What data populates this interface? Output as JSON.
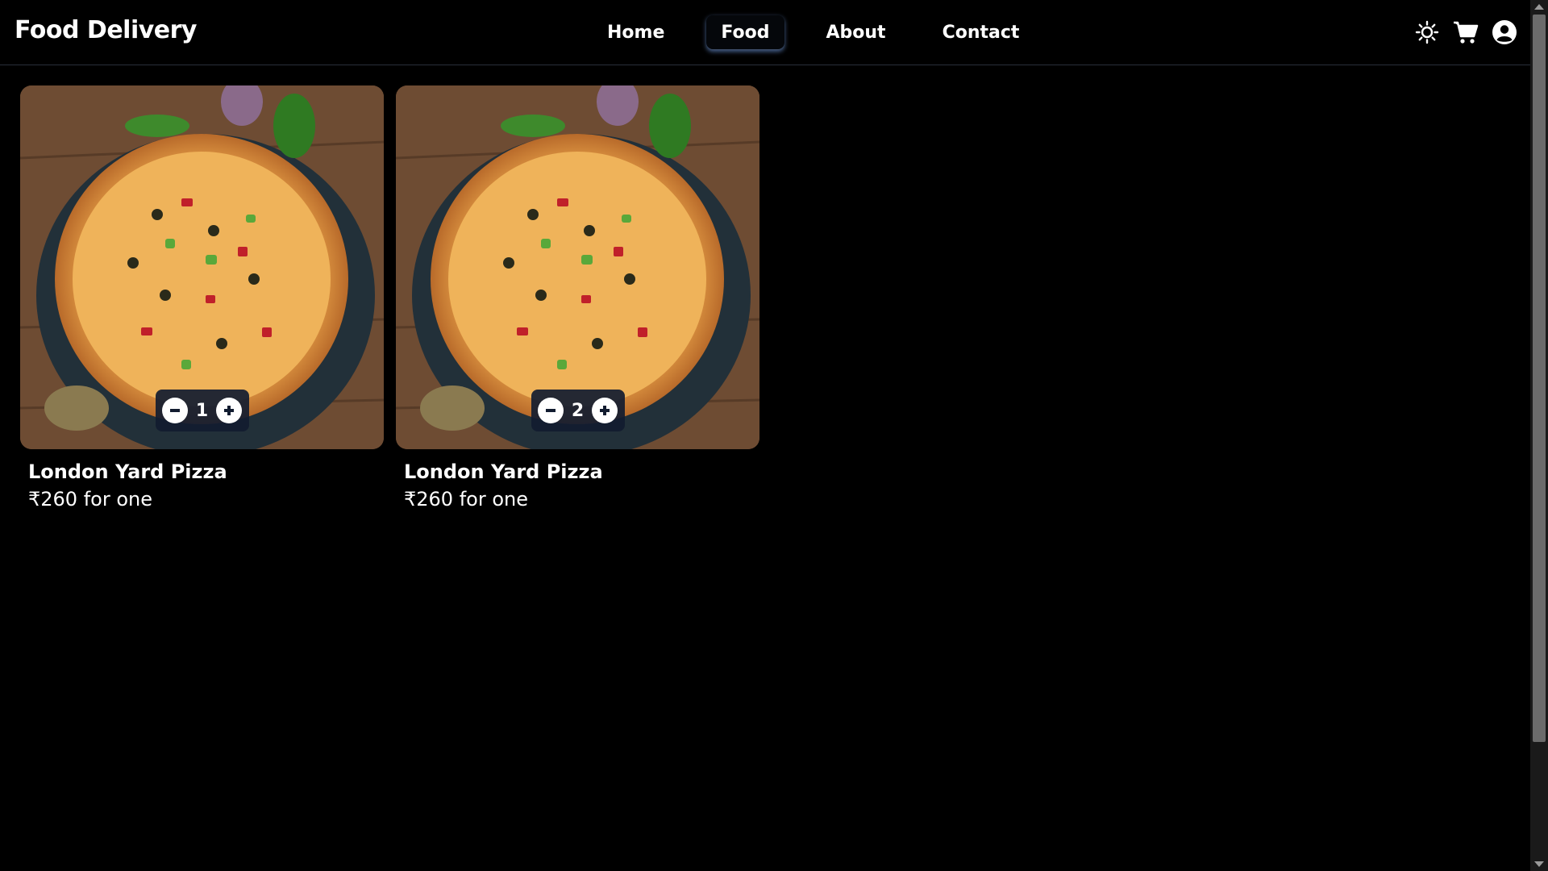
{
  "brand": "Food Delivery",
  "nav": {
    "links": [
      "Home",
      "Food",
      "About",
      "Contact"
    ],
    "active": "Food"
  },
  "icons": {
    "theme": "sun-icon",
    "cart": "cart-icon",
    "profile": "user-circle-icon"
  },
  "items": [
    {
      "title": "London Yard Pizza",
      "price": "₹260 for one",
      "quantity": "1"
    },
    {
      "title": "London Yard Pizza",
      "price": "₹260 for one",
      "quantity": "2"
    }
  ],
  "colors": {
    "background": "#000000",
    "stepper_bg": "#121c30",
    "active_glow": "#506ea0"
  }
}
